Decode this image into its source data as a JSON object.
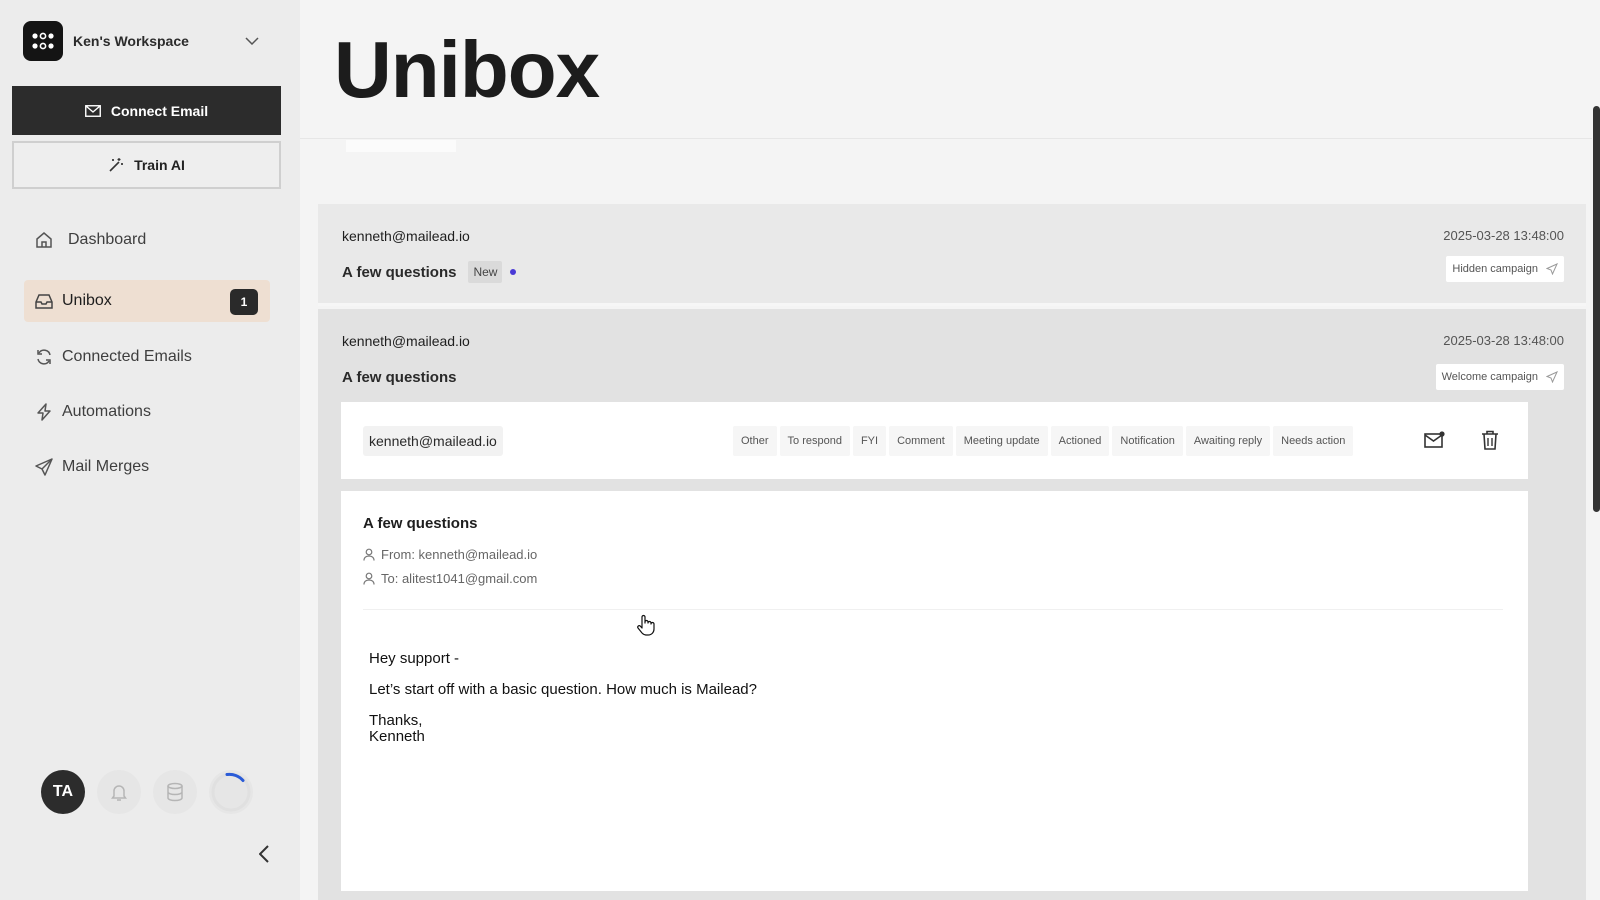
{
  "sidebar": {
    "workspace_name": "Ken's Workspace",
    "connect_email": "Connect Email",
    "train_ai": "Train AI",
    "nav": [
      {
        "label": "Dashboard",
        "icon": "home-icon"
      },
      {
        "label": "Unibox",
        "icon": "inbox-icon",
        "badge": "1",
        "active": true
      },
      {
        "label": "Connected Emails",
        "icon": "refresh-icon"
      },
      {
        "label": "Automations",
        "icon": "bolt-icon"
      },
      {
        "label": "Mail Merges",
        "icon": "send-icon"
      }
    ],
    "avatar_initials": "TA"
  },
  "main": {
    "title": "Unibox",
    "threads": [
      {
        "from": "kenneth@mailead.io",
        "date": "2025-03-28 13:48:00",
        "subject": "A few questions",
        "tag": "New",
        "campaign": "Hidden campaign"
      },
      {
        "from": "kenneth@mailead.io",
        "date": "2025-03-28 13:48:00",
        "subject": "A few questions",
        "campaign": "Welcome campaign"
      }
    ],
    "message": {
      "sender": "kenneth@mailead.io",
      "labels": [
        "Other",
        "To respond",
        "FYI",
        "Comment",
        "Meeting update",
        "Actioned",
        "Notification",
        "Awaiting reply",
        "Needs action"
      ],
      "subject": "A few questions",
      "from_line": "From: kenneth@mailead.io",
      "to_line": "To: alitest1041@gmail.com",
      "body": {
        "greeting": "Hey support -",
        "line1": "Let’s start off with a basic question. How much is Mailead?",
        "signoff": "Thanks,",
        "name": "Kenneth"
      }
    }
  },
  "colors": {
    "accent_dark": "#2c2c2c",
    "active_nav": "#eedfd2",
    "unread_dot": "#4a3ad6"
  }
}
